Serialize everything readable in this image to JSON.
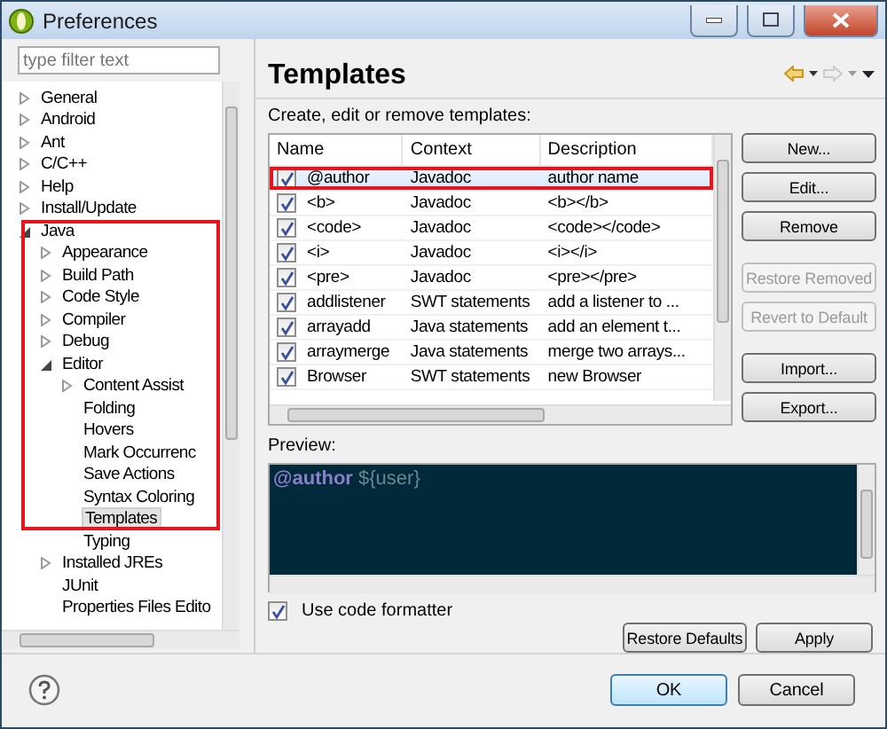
{
  "window": {
    "title": "Preferences"
  },
  "filter": {
    "placeholder": "type filter text"
  },
  "tree": [
    {
      "label": "General",
      "expanded": false,
      "selected": false
    },
    {
      "label": "Android",
      "expanded": false,
      "selected": false
    },
    {
      "label": "Ant",
      "expanded": false,
      "selected": false
    },
    {
      "label": "C/C++",
      "expanded": false,
      "selected": false
    },
    {
      "label": "Help",
      "expanded": false,
      "selected": false
    },
    {
      "label": "Install/Update",
      "expanded": false,
      "selected": false
    },
    {
      "label": "Java",
      "expanded": true,
      "selected": false,
      "annotated": true,
      "children": [
        {
          "label": "Appearance",
          "expanded": false,
          "selected": false
        },
        {
          "label": "Build Path",
          "expanded": false,
          "selected": false
        },
        {
          "label": "Code Style",
          "expanded": false,
          "selected": false
        },
        {
          "label": "Compiler",
          "expanded": false,
          "selected": false
        },
        {
          "label": "Debug",
          "expanded": false,
          "selected": false
        },
        {
          "label": "Editor",
          "expanded": true,
          "selected": false,
          "children": [
            {
              "label": "Content Assist",
              "expanded": false,
              "selected": false
            },
            {
              "label": "Folding",
              "selected": false
            },
            {
              "label": "Hovers",
              "selected": false
            },
            {
              "label": "Mark Occurrenc",
              "selected": false
            },
            {
              "label": "Save Actions",
              "selected": false
            },
            {
              "label": "Syntax Coloring",
              "selected": false
            },
            {
              "label": "Templates",
              "selected": true
            },
            {
              "label": "Typing",
              "selected": false,
              "annotated": false
            }
          ]
        },
        {
          "label": "Installed JREs",
          "expanded": false,
          "selected": false,
          "annotated": false
        },
        {
          "label": "JUnit",
          "selected": false,
          "annotated": false
        },
        {
          "label": "Properties Files Edito",
          "selected": false,
          "annotated": false
        }
      ]
    }
  ],
  "page": {
    "title": "Templates",
    "label": "Create, edit or remove templates:"
  },
  "table": {
    "columns": [
      "Name",
      "Context",
      "Description"
    ],
    "rows": [
      {
        "checked": true,
        "selected": true,
        "annotated": true,
        "name": "@author",
        "context": "Javadoc",
        "description": "author name"
      },
      {
        "checked": true,
        "selected": false,
        "name": "<b>",
        "context": "Javadoc",
        "description": "<b></b>"
      },
      {
        "checked": true,
        "selected": false,
        "name": "<code>",
        "context": "Javadoc",
        "description": "<code></code>"
      },
      {
        "checked": true,
        "selected": false,
        "name": "<i>",
        "context": "Javadoc",
        "description": "<i></i>"
      },
      {
        "checked": true,
        "selected": false,
        "name": "<pre>",
        "context": "Javadoc",
        "description": "<pre></pre>"
      },
      {
        "checked": true,
        "selected": false,
        "name": "addlistener",
        "context": "SWT statements",
        "description": "add a listener to ..."
      },
      {
        "checked": true,
        "selected": false,
        "name": "arrayadd",
        "context": "Java statements",
        "description": "add an element t..."
      },
      {
        "checked": true,
        "selected": false,
        "name": "arraymerge",
        "context": "Java statements",
        "description": "merge two arrays..."
      },
      {
        "checked": true,
        "selected": false,
        "name": "Browser",
        "context": "SWT statements",
        "description": "new Browser"
      }
    ]
  },
  "side_buttons": [
    [
      {
        "label": "New...",
        "disabled": false
      },
      {
        "label": "Edit...",
        "disabled": false
      },
      {
        "label": "Remove",
        "disabled": false
      }
    ],
    [
      {
        "label": "Restore Removed",
        "disabled": true
      },
      {
        "label": "Revert to Default",
        "disabled": true
      }
    ],
    [
      {
        "label": "Import...",
        "disabled": false
      },
      {
        "label": "Export...",
        "disabled": false
      }
    ]
  ],
  "preview": {
    "label": "Preview:",
    "tag": "@author",
    "variable": "${user}"
  },
  "use_code_formatter": {
    "label": "Use code formatter",
    "checked": true
  },
  "page_buttons": [
    "Restore Defaults",
    "Apply"
  ],
  "dialog_buttons": [
    {
      "label": "OK",
      "default": true
    },
    {
      "label": "Cancel",
      "default": false
    }
  ]
}
